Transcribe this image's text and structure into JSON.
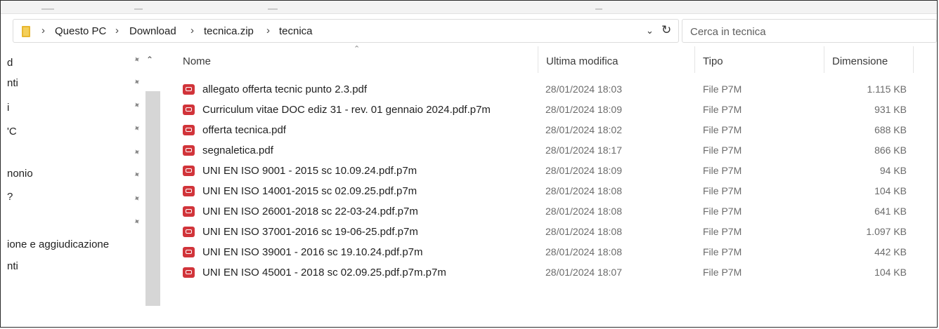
{
  "address": {
    "crumbs": [
      "Questo PC",
      "Download",
      "tecnica.zip",
      "tecnica"
    ],
    "separator": "›"
  },
  "search": {
    "placeholder": "Cerca in tecnica"
  },
  "nav": {
    "items": [
      "d",
      "nti",
      "i",
      "'C",
      "",
      "nonio",
      "?",
      "",
      "ione e aggiudicazione",
      "nti"
    ]
  },
  "columns": {
    "name": "Nome",
    "modified": "Ultima modifica",
    "type": "Tipo",
    "size": "Dimensione"
  },
  "files": [
    {
      "name": "allegato offerta tecnic punto 2.3.pdf",
      "modified": "28/01/2024 18:03",
      "type": "File P7M",
      "size": "1.115 KB"
    },
    {
      "name": "Curriculum vitae DOC ediz 31 - rev. 01 gennaio 2024.pdf.p7m",
      "modified": "28/01/2024 18:09",
      "type": "File P7M",
      "size": "931 KB"
    },
    {
      "name": "offerta tecnica.pdf",
      "modified": "28/01/2024 18:02",
      "type": "File P7M",
      "size": "688 KB"
    },
    {
      "name": "segnaletica.pdf",
      "modified": "28/01/2024 18:17",
      "type": "File P7M",
      "size": "866 KB"
    },
    {
      "name": "UNI EN ISO 9001 - 2015 sc 10.09.24.pdf.p7m",
      "modified": "28/01/2024 18:09",
      "type": "File P7M",
      "size": "94 KB"
    },
    {
      "name": "UNI EN ISO 14001-2015 sc 02.09.25.pdf.p7m",
      "modified": "28/01/2024 18:08",
      "type": "File P7M",
      "size": "104 KB"
    },
    {
      "name": "UNI EN ISO 26001-2018 sc 22-03-24.pdf.p7m",
      "modified": "28/01/2024 18:08",
      "type": "File P7M",
      "size": "641 KB"
    },
    {
      "name": "UNI EN ISO 37001-2016 sc 19-06-25.pdf.p7m",
      "modified": "28/01/2024 18:08",
      "type": "File P7M",
      "size": "1.097 KB"
    },
    {
      "name": "UNI EN ISO 39001 - 2016 sc 19.10.24.pdf.p7m",
      "modified": "28/01/2024 18:08",
      "type": "File P7M",
      "size": "442 KB"
    },
    {
      "name": "UNI EN ISO 45001 - 2018  sc 02.09.25.pdf.p7m.p7m",
      "modified": "28/01/2024 18:07",
      "type": "File P7M",
      "size": "104 KB"
    }
  ],
  "colors": {
    "pdf_icon": "#d1343a",
    "folder": "#e8b730"
  }
}
